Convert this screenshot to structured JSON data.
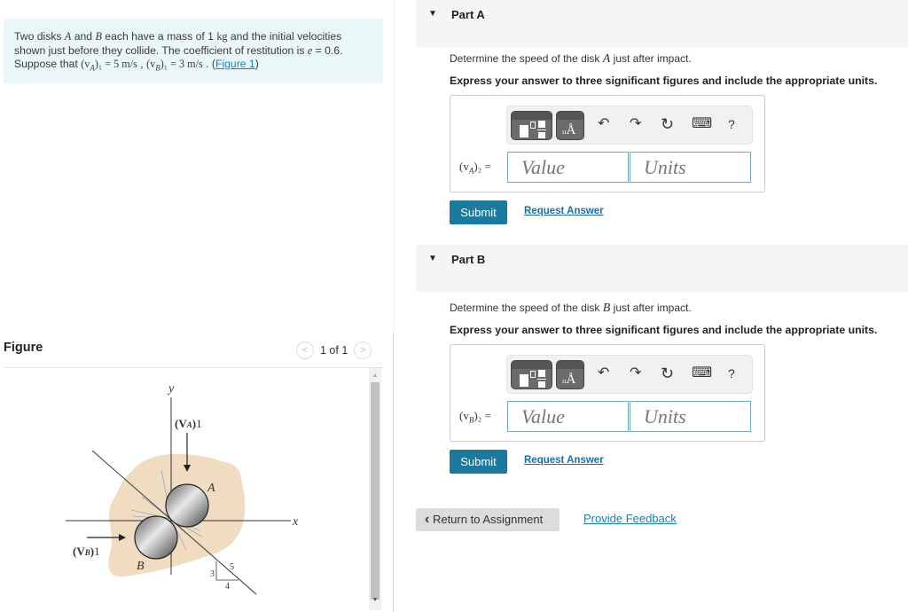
{
  "problem": {
    "text_1": "Two disks ",
    "disk_a": "A",
    "text_2": " and ",
    "disk_b": "B",
    "text_3": " each have a mass of 1 ",
    "mass_unit": "kg",
    "text_4": " and the initial velocities shown just before they collide. The coefficient of restitution is ",
    "e_symbol": "e",
    "text_5": " = 0.6. Suppose that ",
    "va_symbol": "(v",
    "va_sub": "A",
    "va_tail": ")₁",
    "va_value": " = 5  m/s",
    "sep": " , ",
    "vb_symbol": "(v",
    "vb_sub": "B",
    "vb_tail": ")₁",
    "vb_value": " = 3  m/s",
    "text_6": " . (",
    "figure_link": "Figure 1",
    "text_7": ")"
  },
  "figure": {
    "header": "Figure",
    "pager": "1 of 1",
    "prev_icon": "chevron-left-icon",
    "next_icon": "chevron-right-icon",
    "labels": {
      "y_axis": "y",
      "x_axis": "x",
      "va1": "(vA)1",
      "vb1": "(vB)1",
      "disk_a": "A",
      "disk_b": "B",
      "slope_3": "3",
      "slope_4": "4",
      "slope_5": "5"
    }
  },
  "parts": [
    {
      "title": "Part A",
      "question_pre": "Determine the speed of the disk ",
      "question_var": "A",
      "question_post": " just after impact.",
      "instruction": "Express your answer to three significant figures and include the appropriate units.",
      "label_pre": "(v",
      "label_sub": "A",
      "label_post": ")₂ =",
      "value_placeholder": "Value",
      "units_placeholder": "Units",
      "submit": "Submit",
      "request": "Request Answer"
    },
    {
      "title": "Part B",
      "question_pre": "Determine the speed of the disk ",
      "question_var": "B",
      "question_post": " just after impact.",
      "instruction": "Express your answer to three significant figures and include the appropriate units.",
      "label_pre": "(v",
      "label_sub": "B",
      "label_post": ")₂ =",
      "value_placeholder": "Value",
      "units_placeholder": "Units",
      "submit": "Submit",
      "request": "Request Answer"
    }
  ],
  "toolbar": {
    "undo": "↶",
    "redo": "↷",
    "reset": "↻",
    "keyboard": "⌨",
    "help": "?"
  },
  "footer": {
    "return": "Return to Assignment",
    "return_icon": "‹",
    "feedback": "Provide Feedback"
  }
}
